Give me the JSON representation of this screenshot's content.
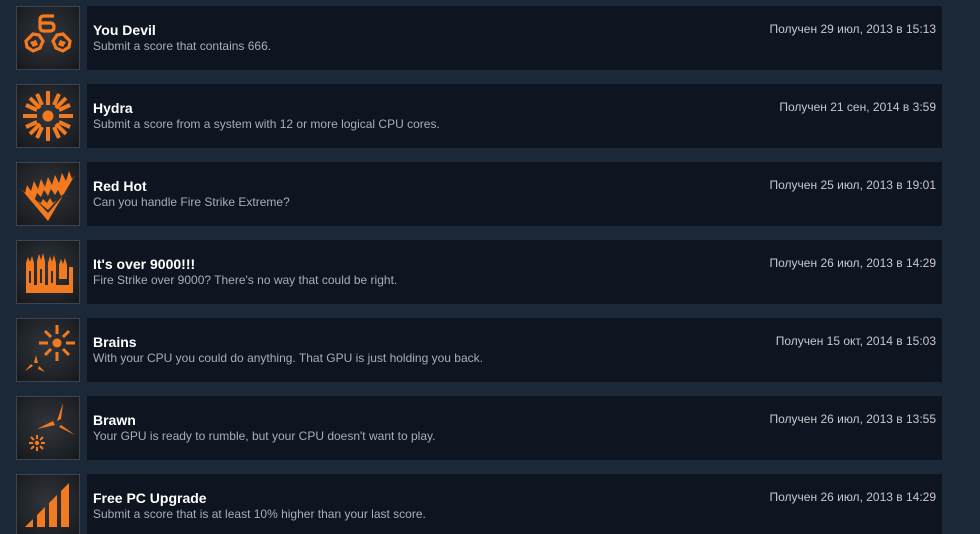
{
  "accent_color": "#f47a1f",
  "achievements": [
    {
      "icon": "devil-666-icon",
      "title": "You Devil",
      "description": "Submit a score that contains 666.",
      "unlocked": "Получен 29 июл, 2013 в 15:13"
    },
    {
      "icon": "hydra-burst-icon",
      "title": "Hydra",
      "description": "Submit a score from a system with 12 or more logical CPU cores.",
      "unlocked": "Получен 21 сен, 2014 в 3:59"
    },
    {
      "icon": "flame-v-icon",
      "title": "Red Hot",
      "description": "Can you handle Fire Strike Extreme?",
      "unlocked": "Получен 25 июл, 2013 в 19:01"
    },
    {
      "icon": "over-9000-icon",
      "title": "It's over 9000!!!",
      "description": "Fire Strike over 9000? There's no way that could be right.",
      "unlocked": "Получен 26 июл, 2013 в 14:29"
    },
    {
      "icon": "brains-icon",
      "title": "Brains",
      "description": "With your CPU you could do anything. That GPU is just holding you back.",
      "unlocked": "Получен 15 окт, 2014 в 15:03"
    },
    {
      "icon": "brawn-icon",
      "title": "Brawn",
      "description": "Your GPU is ready to rumble, but your CPU doesn't want to play.",
      "unlocked": "Получен 26 июл, 2013 в 13:55"
    },
    {
      "icon": "signal-bars-icon",
      "title": "Free PC Upgrade",
      "description": "Submit a score that is at least 10% higher than your last score.",
      "unlocked": "Получен 26 июл, 2013 в 14:29"
    }
  ]
}
